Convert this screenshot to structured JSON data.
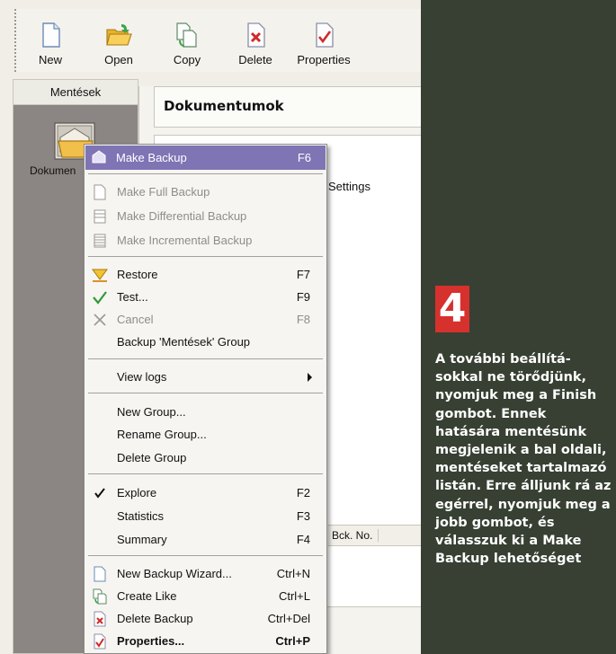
{
  "toolbar": {
    "buttons": [
      {
        "label": "New",
        "icon": "new-document-icon"
      },
      {
        "label": "Open",
        "icon": "open-folder-icon"
      },
      {
        "label": "Copy",
        "icon": "copy-icon"
      },
      {
        "label": "Delete",
        "icon": "delete-icon"
      },
      {
        "label": "Properties",
        "icon": "properties-icon"
      }
    ]
  },
  "sidebar": {
    "tab_label": "Mentések",
    "item_label": "Dokumen"
  },
  "main": {
    "title": "Dokumentumok",
    "settings_label": "Settings",
    "column_bck_no": "Bck. No."
  },
  "context_menu": {
    "items": [
      {
        "label": "Make Backup",
        "shortcut": "F6",
        "icon": "make-backup-icon"
      },
      {
        "label": "Make Full Backup",
        "shortcut": "",
        "icon": "full-backup-icon"
      },
      {
        "label": "Make Differential Backup",
        "shortcut": "",
        "icon": "differential-backup-icon"
      },
      {
        "label": "Make Incremental Backup",
        "shortcut": "",
        "icon": "incremental-backup-icon"
      },
      {
        "label": "Restore",
        "shortcut": "F7",
        "icon": "restore-icon"
      },
      {
        "label": "Test...",
        "shortcut": "F9",
        "icon": "checkmark-icon"
      },
      {
        "label": "Cancel",
        "shortcut": "F8",
        "icon": "cancel-x-icon"
      },
      {
        "label": "Backup 'Mentések' Group",
        "shortcut": ""
      },
      {
        "label": "View logs",
        "shortcut": ""
      },
      {
        "label": "New Group...",
        "shortcut": ""
      },
      {
        "label": "Rename Group...",
        "shortcut": ""
      },
      {
        "label": "Delete Group",
        "shortcut": ""
      },
      {
        "label": "Explore",
        "shortcut": "F2",
        "icon": "check-mark-icon"
      },
      {
        "label": "Statistics",
        "shortcut": "F3"
      },
      {
        "label": "Summary",
        "shortcut": "F4"
      },
      {
        "label": "New Backup Wizard...",
        "shortcut": "Ctrl+N",
        "icon": "new-document-icon"
      },
      {
        "label": "Create Like",
        "shortcut": "Ctrl+L",
        "icon": "copy-icon"
      },
      {
        "label": "Delete Backup",
        "shortcut": "Ctrl+Del",
        "icon": "delete-icon"
      },
      {
        "label": "Properties...",
        "shortcut": "Ctrl+P",
        "icon": "properties-icon"
      }
    ]
  },
  "caption": {
    "step_number": "4",
    "text": "A további beállítá-sokkal ne törődjünk, nyomjuk meg a Finish gombot. Ennek hatására mentésünk megjelenik a bal oldali, mentéseket tartalmazó listán. Erre álljunk rá az egérrel, nyomjuk meg a jobb gombot, és válasszuk ki a Make Backup lehetőséget"
  },
  "colors": {
    "menu_highlight": "#7f74b4",
    "magazine_bg": "#374032",
    "step_box": "#d6312d",
    "side_list_bg": "#8b8583"
  }
}
